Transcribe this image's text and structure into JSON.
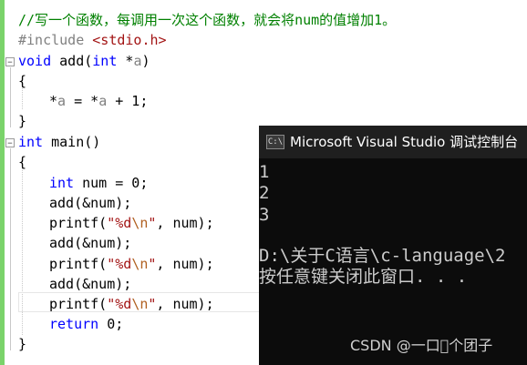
{
  "code": {
    "comment": "//写一个函数，每调用一次这个函数，就会将num的值增加1。",
    "include_directive": "#include",
    "include_header": "<stdio.h>",
    "line3_kw": "void",
    "line3_rest": " add(",
    "line3_int": "int",
    "line3_star": " *",
    "line3_param": "a",
    "line3_close": ")",
    "brace_open": "{",
    "line5_star1": "*",
    "line5_a1": "a",
    "line5_mid": " = *",
    "line5_a2": "a",
    "line5_end": " + 1;",
    "brace_close": "}",
    "line7_kw": "int",
    "line7_rest": " main()",
    "line9_kw": "int",
    "line9_rest": " num = 0;",
    "add_call": "add(&num);",
    "printf_open": "printf(",
    "printf_fmt1": "\"%d",
    "printf_esc": "\\n",
    "printf_fmt2": "\"",
    "printf_tail": ", num);",
    "return_kw": "return",
    "return_rest": " 0;"
  },
  "console": {
    "title": "Microsoft Visual Studio 调试控制台",
    "icon": "vs-console-icon",
    "icon_glyph": "C:\\",
    "output": [
      "1",
      "2",
      "3"
    ],
    "path_line": "D:\\关于C语言\\c-language\\2",
    "prompt_line": "按任意键关闭此窗口. . ."
  },
  "watermark": "CSDN @一口\u0000个团子",
  "colors": {
    "comment": "#008000",
    "keyword": "#0000ff",
    "string": "#a31515",
    "console_bg": "#0c0c0c",
    "console_title_bg": "#1f1f1f",
    "margin_green": "#7ad36a"
  }
}
